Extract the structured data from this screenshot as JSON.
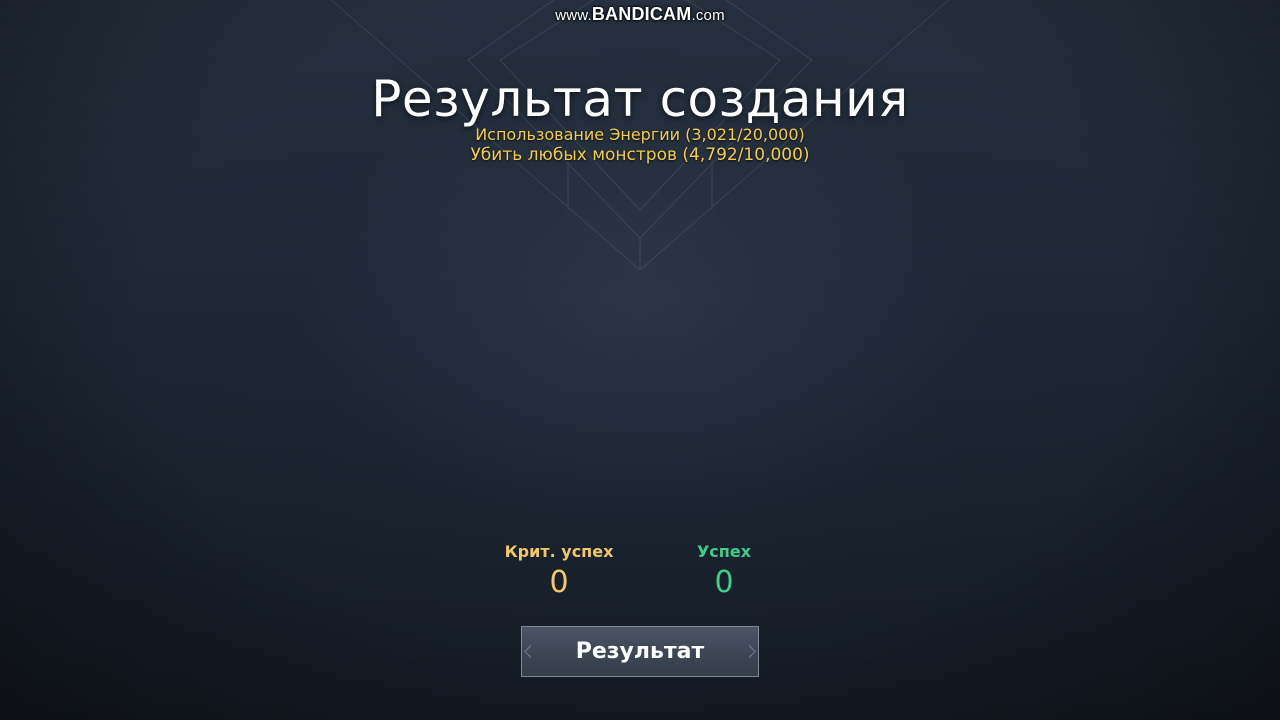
{
  "watermark": {
    "prefix": "www.",
    "brand": "BANDICAM",
    "suffix": ".com"
  },
  "title": "Результат создания",
  "quests": [
    "Использование Энергии (3,021/20,000)",
    "Убить любых монстров (4,792/10,000)"
  ],
  "stats": {
    "crit": {
      "label": "Крит. успех",
      "value": "0"
    },
    "success": {
      "label": "Успех",
      "value": "0"
    }
  },
  "result_button": {
    "label": "Результат"
  },
  "colors": {
    "quest_text": "#f2cc4c",
    "crit": "#f0c865",
    "success": "#3fce8a",
    "background": "#1d2633"
  }
}
